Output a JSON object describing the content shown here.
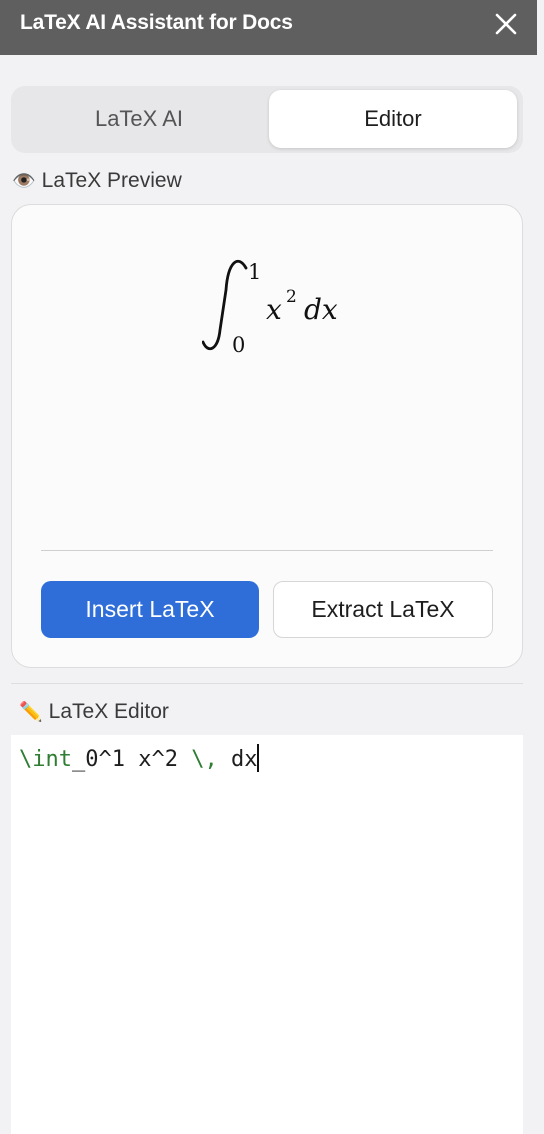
{
  "window": {
    "title": "LaTeX AI Assistant for Docs",
    "close_icon": "close-icon"
  },
  "tabs": [
    {
      "label": "LaTeX AI",
      "selected": false
    },
    {
      "label": "Editor",
      "selected": true
    }
  ],
  "preview": {
    "emoji": "👁️",
    "label": "LaTeX Preview",
    "formula": {
      "lower": "0",
      "upper": "1",
      "base": "x",
      "exponent": "2",
      "differential": "dx"
    },
    "insert_label": "Insert LaTeX",
    "extract_label": "Extract LaTeX"
  },
  "editor": {
    "emoji": "✏️",
    "label": "LaTeX Editor",
    "code_tokens": [
      {
        "text": "\\int",
        "type": "command"
      },
      {
        "text": "_0^1 x^2 ",
        "type": "plain"
      },
      {
        "text": "\\,",
        "type": "command"
      },
      {
        "text": " dx",
        "type": "plain"
      }
    ]
  },
  "colors": {
    "titlebar": "#5f5f5f",
    "accent": "#2f6ed8",
    "latex_command": "#2e7d32"
  }
}
